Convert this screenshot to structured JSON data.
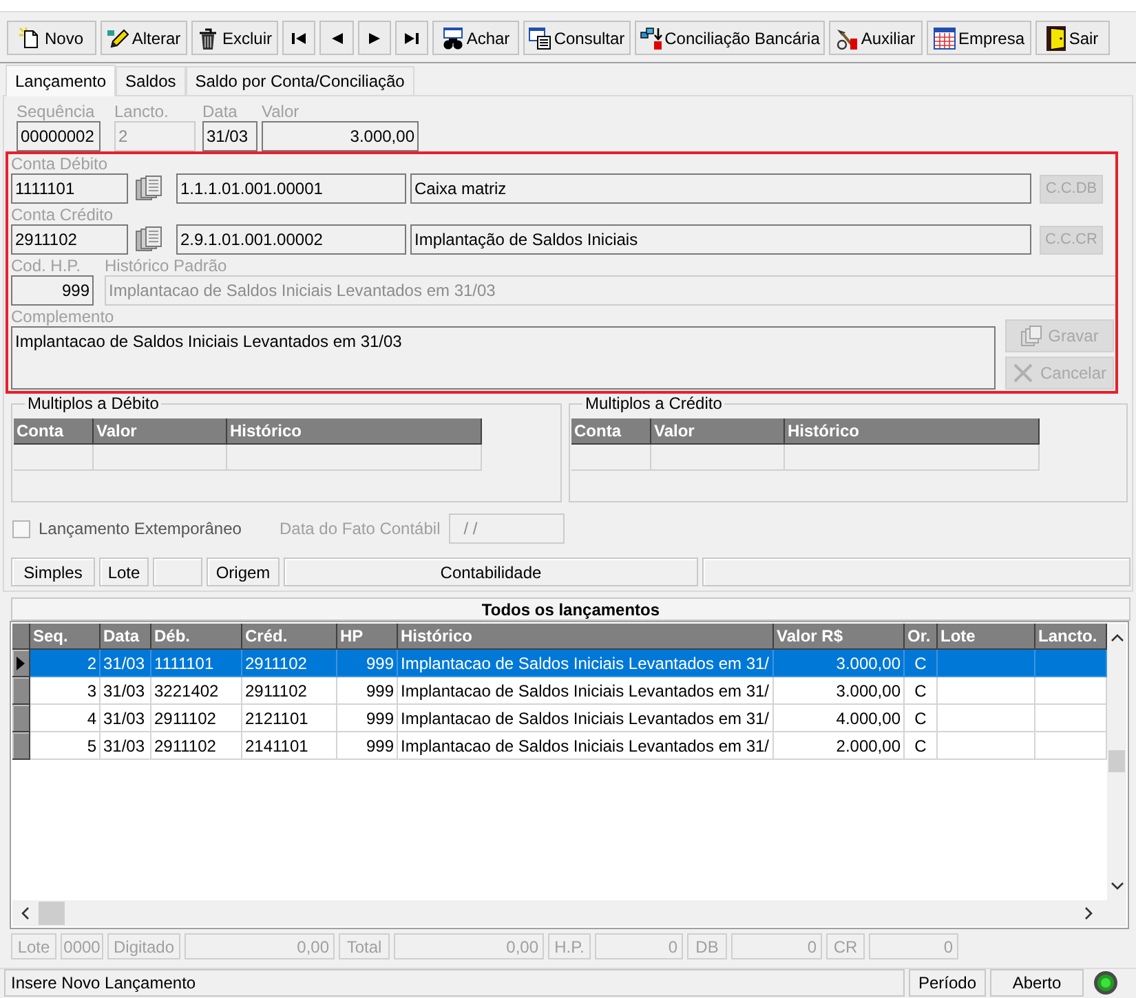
{
  "toolbar": [
    {
      "kind": "labeled",
      "label": "Novo"
    },
    {
      "kind": "labeled",
      "label": "Alterar"
    },
    {
      "kind": "labeled",
      "label": "Excluir"
    },
    {
      "kind": "icon_only"
    },
    {
      "kind": "icon_only"
    },
    {
      "kind": "icon_only"
    },
    {
      "kind": "icon_only"
    },
    {
      "kind": "labeled",
      "label": "Achar"
    },
    {
      "kind": "labeled",
      "label": "Consultar"
    },
    {
      "kind": "labeled",
      "label": "Conciliação Bancária"
    },
    {
      "kind": "labeled",
      "label": "Auxiliar"
    },
    {
      "kind": "labeled",
      "label": "Empresa"
    },
    {
      "kind": "labeled",
      "label": "Sair"
    }
  ],
  "tabs": [
    {
      "label": "Lançamento",
      "selected": true
    },
    {
      "label": "Saldos",
      "selected": false
    },
    {
      "label": "Saldo por Conta/Conciliação",
      "selected": false
    }
  ],
  "entry": [
    {
      "kind": "text",
      "label": "Sequência",
      "value": "00000002",
      "disabled": false
    },
    {
      "kind": "text",
      "label": "Lancto.",
      "value": "2",
      "disabled": true
    },
    {
      "kind": "text",
      "label": "Data",
      "value": "31/03",
      "disabled": false
    },
    {
      "kind": "amount",
      "label": "Valor",
      "value": "3.000,00",
      "disabled": false
    }
  ],
  "accounts": {
    "highlighted": true,
    "rows": [
      {
        "label": "Conta Débito",
        "code": "1111101",
        "number": "1.1.1.01.001.00001",
        "name": "Caixa matriz",
        "button": {
          "label": "C.C.DB",
          "disabled": true
        }
      },
      {
        "label": "Conta Crédito",
        "code": "2911102",
        "number": "2.9.1.01.001.00002",
        "name": "Implantação de Saldos Iniciais",
        "button": {
          "label": "C.C.CR",
          "disabled": true
        }
      }
    ],
    "history": {
      "code_label": "Cod. H.P.",
      "code": "999",
      "text_label": "Histórico Padrão",
      "text": "Implantacao de Saldos Iniciais Levantados em 31/03",
      "text_disabled": true
    },
    "complement": {
      "label": "Complemento",
      "value": "Implantacao de Saldos Iniciais Levantados em 31/03"
    },
    "actions": [
      {
        "label": "Gravar",
        "disabled": true
      },
      {
        "label": "Cancelar",
        "disabled": true
      }
    ]
  },
  "multiples": [
    {
      "title": "Multiplos a Débito",
      "columns": [
        "Conta",
        "Valor",
        "Histórico"
      ]
    },
    {
      "title": "Multiplos a Crédito",
      "columns": [
        "Conta",
        "Valor",
        "Histórico"
      ]
    }
  ],
  "extemporaneous": {
    "label": "Lançamento Extemporâneo",
    "checked": false
  },
  "fact_date": {
    "label": "Data do Fato Contábil",
    "value": "/ /"
  },
  "origin_bar": [
    {
      "kind": "text",
      "text": "Simples"
    },
    {
      "kind": "text",
      "text": "Lote"
    },
    {
      "kind": "blank"
    },
    {
      "kind": "text",
      "text": "Origem"
    },
    {
      "kind": "text",
      "text": "Contabilidade"
    },
    {
      "kind": "blank"
    }
  ],
  "entries_grid": {
    "title": "Todos os lançamentos",
    "columns": [
      "Seq.",
      "Data",
      "Déb.",
      "Créd.",
      "HP",
      "Histórico",
      "Valor R$",
      "Or.",
      "Lote",
      "Lancto."
    ],
    "rows": [
      {
        "selected": true,
        "cells": [
          "2",
          "31/03",
          "1111101",
          "2911102",
          "999",
          "Implantacao de Saldos Iniciais Levantados em 31/",
          "3.000,00",
          "C"
        ]
      },
      {
        "selected": false,
        "cells": [
          "3",
          "31/03",
          "3221402",
          "2911102",
          "999",
          "Implantacao de Saldos Iniciais Levantados em 31/",
          "3.000,00",
          "C"
        ]
      },
      {
        "selected": false,
        "cells": [
          "4",
          "31/03",
          "2911102",
          "2121101",
          "999",
          "Implantacao de Saldos Iniciais Levantados em 31/",
          "4.000,00",
          "C"
        ]
      },
      {
        "selected": false,
        "cells": [
          "5",
          "31/03",
          "2911102",
          "2141101",
          "999",
          "Implantacao de Saldos Iniciais Levantados em 31/",
          "2.000,00",
          "C"
        ]
      }
    ]
  },
  "totals": [
    {
      "kind": "label",
      "text": "Lote"
    },
    {
      "kind": "label",
      "text": "0000"
    },
    {
      "kind": "label",
      "text": "Digitado"
    },
    {
      "kind": "value",
      "text": "0,00"
    },
    {
      "kind": "label",
      "text": "Total"
    },
    {
      "kind": "value",
      "text": "0,00"
    },
    {
      "kind": "label",
      "text": "H.P."
    },
    {
      "kind": "value",
      "text": "0"
    },
    {
      "kind": "label",
      "text": "DB"
    },
    {
      "kind": "value",
      "text": "0"
    },
    {
      "kind": "label",
      "text": "CR"
    },
    {
      "kind": "value",
      "text": "0"
    }
  ],
  "status_bar": {
    "message": "Insere Novo Lançamento",
    "panels": [
      "Período",
      "Aberto"
    ]
  }
}
